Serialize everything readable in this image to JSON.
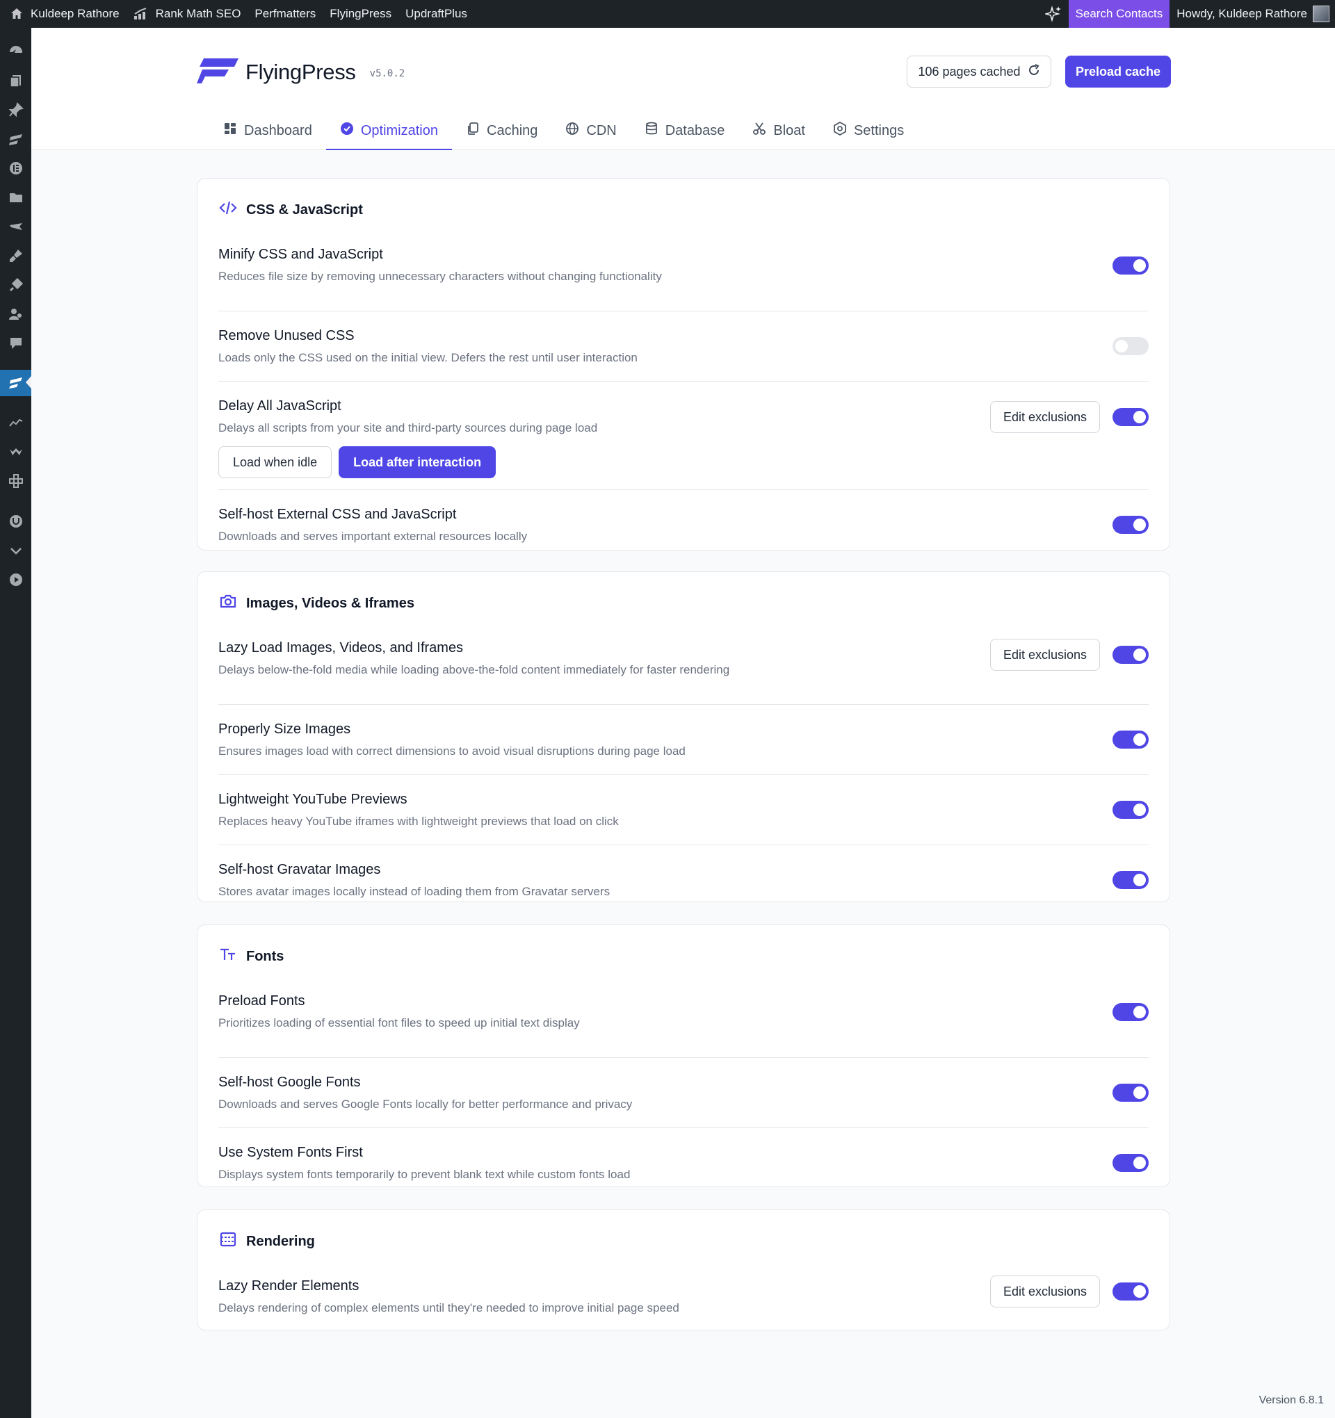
{
  "adminbar": {
    "site_name": "Kuldeep Rathore",
    "menu": [
      "Rank Math SEO",
      "Perfmatters",
      "FlyingPress",
      "UpdraftPlus"
    ],
    "search_label": "Search Contacts",
    "greeting": "Howdy, Kuldeep Rathore"
  },
  "sidebar_icons": [
    "dashboard-icon",
    "pages-icon",
    "pin-icon",
    "flyingpress-icon",
    "elementor-icon",
    "folder-icon",
    "slides-icon",
    "brush-icon",
    "plugins-icon",
    "users-icon",
    "comments-icon",
    "flyingpress-active-icon",
    "analytics-icon",
    "woo-icon",
    "extensions-icon",
    "shield-icon",
    "collapse-icon",
    "play-icon"
  ],
  "header": {
    "brand": "FlyingPress",
    "version": "v5.0.2",
    "cache_status": "106 pages cached",
    "preload_label": "Preload cache"
  },
  "tabs": [
    {
      "label": "Dashboard",
      "icon": "dashboard-grid-icon"
    },
    {
      "label": "Optimization",
      "icon": "check-circle-icon"
    },
    {
      "label": "Caching",
      "icon": "copy-icon"
    },
    {
      "label": "CDN",
      "icon": "globe-icon"
    },
    {
      "label": "Database",
      "icon": "database-icon"
    },
    {
      "label": "Bloat",
      "icon": "scissors-icon"
    },
    {
      "label": "Settings",
      "icon": "settings-icon"
    }
  ],
  "active_tab": "Optimization",
  "sections": {
    "css_js": {
      "title": "CSS & JavaScript",
      "rows": [
        {
          "title": "Minify CSS and JavaScript",
          "desc": "Reduces file size by removing unnecessary characters without changing functionality",
          "enabled": true
        },
        {
          "title": "Remove Unused CSS",
          "desc": "Loads only the CSS used on the initial view. Defers the rest until user interaction",
          "enabled": false
        },
        {
          "title": "Delay All JavaScript",
          "desc": "Delays all scripts from your site and third-party sources during page load",
          "enabled": true,
          "exclusions": "Edit exclusions",
          "options": [
            "Load when idle",
            "Load after interaction"
          ],
          "selected_option": "Load after interaction"
        },
        {
          "title": "Self-host External CSS and JavaScript",
          "desc": "Downloads and serves important external resources locally",
          "enabled": true
        }
      ]
    },
    "media": {
      "title": "Images, Videos & Iframes",
      "rows": [
        {
          "title": "Lazy Load Images, Videos, and Iframes",
          "desc": "Delays below-the-fold media while loading above-the-fold content immediately for faster rendering",
          "enabled": true,
          "exclusions": "Edit exclusions"
        },
        {
          "title": "Properly Size Images",
          "desc": "Ensures images load with correct dimensions to avoid visual disruptions during page load",
          "enabled": true
        },
        {
          "title": "Lightweight YouTube Previews",
          "desc": "Replaces heavy YouTube iframes with lightweight previews that load on click",
          "enabled": true
        },
        {
          "title": "Self-host Gravatar Images",
          "desc": "Stores avatar images locally instead of loading them from Gravatar servers",
          "enabled": true
        }
      ]
    },
    "fonts": {
      "title": "Fonts",
      "rows": [
        {
          "title": "Preload Fonts",
          "desc": "Prioritizes loading of essential font files to speed up initial text display",
          "enabled": true
        },
        {
          "title": "Self-host Google Fonts",
          "desc": "Downloads and serves Google Fonts locally for better performance and privacy",
          "enabled": true
        },
        {
          "title": "Use System Fonts First",
          "desc": "Displays system fonts temporarily to prevent blank text while custom fonts load",
          "enabled": true
        }
      ]
    },
    "rendering": {
      "title": "Rendering",
      "rows": [
        {
          "title": "Lazy Render Elements",
          "desc": "Delays rendering of complex elements until they're needed to improve initial page speed",
          "enabled": true,
          "exclusions": "Edit exclusions"
        }
      ]
    }
  },
  "footer": {
    "version": "Version 6.8.1"
  },
  "colors": {
    "accent": "#4f46e5",
    "adminbar": "#1d2327",
    "search_highlight": "#7b4ee8"
  }
}
